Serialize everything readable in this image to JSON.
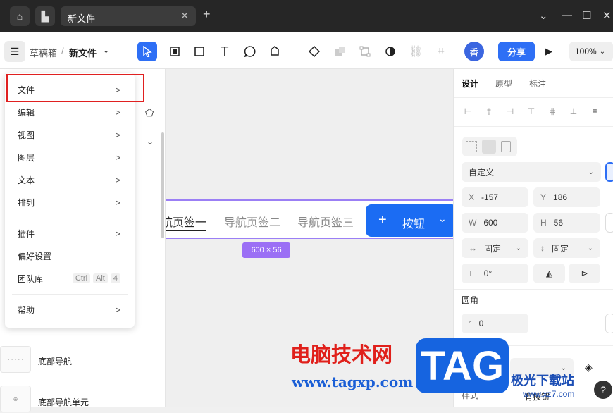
{
  "window": {
    "tab_title": "新文件",
    "close_glyph": "✕",
    "new_tab_glyph": "+",
    "controls": [
      "⌄",
      "—",
      "☐",
      "✕"
    ]
  },
  "toolbar": {
    "crumb_root": "草稿箱",
    "crumb_sep": "/",
    "crumb_file": "新文件",
    "avatar_text": "香",
    "share_label": "分享",
    "zoom_value": "100%"
  },
  "menu": {
    "items": [
      {
        "label": "文件",
        "submenu": true
      },
      {
        "label": "编辑",
        "submenu": true
      },
      {
        "label": "视图",
        "submenu": true
      },
      {
        "label": "图层",
        "submenu": true
      },
      {
        "label": "文本",
        "submenu": true
      },
      {
        "label": "排列",
        "submenu": true
      },
      {
        "label": "插件",
        "submenu": true
      },
      {
        "label": "偏好设置",
        "submenu": false
      },
      {
        "label": "团队库",
        "shortcut": [
          "Ctrl",
          "Alt",
          "4"
        ]
      },
      {
        "label": "帮助",
        "submenu": true
      }
    ],
    "arrow_glyph": ">"
  },
  "left_panel": {
    "components": [
      {
        "label": "底部导航"
      },
      {
        "label": "底部导航单元"
      }
    ]
  },
  "canvas": {
    "nav_tabs": [
      "航页签一",
      "导航页签二",
      "导航页签三"
    ],
    "button_icon": "+",
    "button_label": "按钮",
    "size_badge": "600 × 56"
  },
  "right_panel": {
    "tabs": [
      "设计",
      "原型",
      "标注"
    ],
    "preset": "自定义",
    "x_key": "X",
    "x": "-157",
    "y_key": "Y",
    "y": "186",
    "w_key": "W",
    "w": "600",
    "h_key": "H",
    "h": "56",
    "h_constraint": "固定",
    "v_constraint": "固定",
    "rotation": "0°",
    "corner_label": "圆角",
    "corner_value": "0",
    "style_label": "样式",
    "style_value": "有按钮"
  },
  "watermark": {
    "title": "电脑技术网",
    "url": "www.tagxp.com",
    "tag": "TAG",
    "jg_title": "极光下载站",
    "jg_url": "www.xz7.com"
  },
  "colors": {
    "accent": "#2e6ff5",
    "frame_border": "#9b7ff5",
    "highlight": "#e02020",
    "button": "#1b6cf3"
  }
}
